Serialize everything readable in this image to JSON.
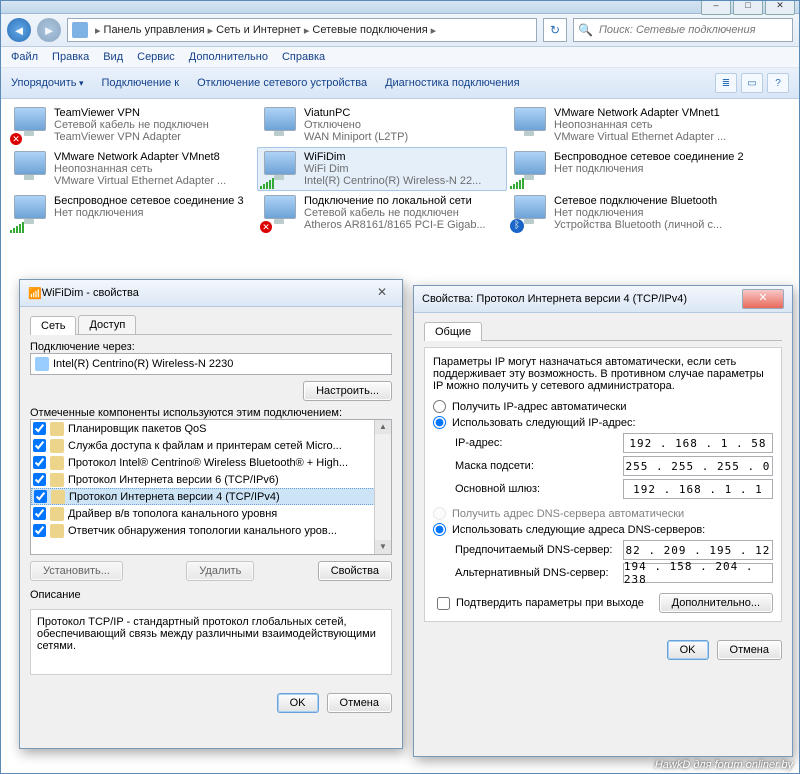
{
  "titlebar": {},
  "nav": {
    "crumb1": "Панель управления",
    "crumb2": "Сеть и Интернет",
    "crumb3": "Сетевые подключения",
    "search_placeholder": "Поиск: Сетевые подключения"
  },
  "menu": {
    "file": "Файл",
    "edit": "Правка",
    "view": "Вид",
    "service": "Сервис",
    "extras": "Дополнительно",
    "help": "Справка"
  },
  "cmd": {
    "organize": "Упорядочить",
    "connect": "Подключение к",
    "disable": "Отключение сетевого устройства",
    "diag": "Диагностика подключения"
  },
  "connections": [
    {
      "n": "TeamViewer VPN",
      "s": "Сетевой кабель не подключен",
      "d": "TeamViewer VPN Adapter",
      "overlay": "x"
    },
    {
      "n": "ViatunPC",
      "s": "Отключено",
      "d": "WAN Miniport (L2TP)",
      "overlay": ""
    },
    {
      "n": "VMware Network Adapter VMnet1",
      "s": "Неопознанная сеть",
      "d": "VMware Virtual Ethernet Adapter ...",
      "overlay": ""
    },
    {
      "n": "VMware Network Adapter VMnet8",
      "s": "Неопознанная сеть",
      "d": "VMware Virtual Ethernet Adapter ...",
      "overlay": ""
    },
    {
      "n": "WiFiDim",
      "s": "WiFi Dim",
      "d": "Intel(R) Centrino(R) Wireless-N 22...",
      "overlay": "bars",
      "sel": true
    },
    {
      "n": "Беспроводное сетевое соединение 2",
      "s": "",
      "d": "Нет подключения",
      "overlay": "bars"
    },
    {
      "n": "Беспроводное сетевое соединение 3",
      "s": "",
      "d": "Нет подключения",
      "overlay": "bars"
    },
    {
      "n": "Подключение по локальной сети",
      "s": "Сетевой кабель не подключен",
      "d": "Atheros AR8161/8165 PCI-E Gigab...",
      "overlay": "x"
    },
    {
      "n": "Сетевое подключение Bluetooth",
      "s": "Нет подключения",
      "d": "Устройства Bluetooth (личной с...",
      "overlay": "bt"
    }
  ],
  "props_dlg": {
    "title": "WiFiDim - свойства",
    "tab_net": "Сеть",
    "tab_access": "Доступ",
    "connect_via": "Подключение через:",
    "adapter": "Intel(R) Centrino(R) Wireless-N 2230",
    "configure": "Настроить...",
    "components_label": "Отмеченные компоненты используются этим подключением:",
    "items": [
      "Планировщик пакетов QoS",
      "Служба доступа к файлам и принтерам сетей Micro...",
      "Протокол Intel® Centrino® Wireless Bluetooth® + High...",
      "Протокол Интернета версии 6 (TCP/IPv6)",
      "Протокол Интернета версии 4 (TCP/IPv4)",
      "Драйвер в/в тополога канального уровня",
      "Ответчик обнаружения топологии канального уров..."
    ],
    "btn_install": "Установить...",
    "btn_remove": "Удалить",
    "btn_props": "Свойства",
    "desc_head": "Описание",
    "desc": "Протокол TCP/IP - стандартный протокол глобальных сетей, обеспечивающий связь между различными взаимодействующими сетями.",
    "ok": "OK",
    "cancel": "Отмена"
  },
  "ip_dlg": {
    "title": "Свойства: Протокол Интернета версии 4 (TCP/IPv4)",
    "tab_general": "Общие",
    "intro": "Параметры IP могут назначаться автоматически, если сеть поддерживает эту возможность. В противном случае параметры IP можно получить у сетевого администратора.",
    "r_auto_ip": "Получить IP-адрес автоматически",
    "r_manual_ip": "Использовать следующий IP-адрес:",
    "k_ip": "IP-адрес:",
    "v_ip": "192 . 168 .  1  . 58",
    "k_mask": "Маска подсети:",
    "v_mask": "255 . 255 . 255 .  0",
    "k_gw": "Основной шлюз:",
    "v_gw": "192 . 168 .  1  .  1",
    "r_auto_dns": "Получить адрес DNS-сервера автоматически",
    "r_manual_dns": "Использовать следующие адреса DNS-серверов:",
    "k_dns1": "Предпочитаемый DNS-сервер:",
    "v_dns1": "82 . 209 . 195 . 12",
    "k_dns2": "Альтернативный DNS-сервер:",
    "v_dns2": "194 . 158 . 204 . 238",
    "validate": "Подтвердить параметры при выходе",
    "advanced": "Дополнительно...",
    "ok": "OK",
    "cancel": "Отмена"
  },
  "watermark": "HawkD для forum.onliner.by"
}
